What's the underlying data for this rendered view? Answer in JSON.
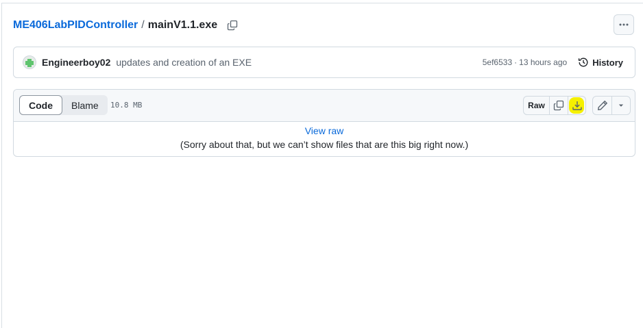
{
  "breadcrumb": {
    "repo": "ME406LabPIDController",
    "separator": "/",
    "file": "mainV1.1.exe"
  },
  "commit": {
    "author": "Engineerboy02",
    "message": "updates and creation of an EXE",
    "sha": "5ef6533",
    "dot": "·",
    "time": "13 hours ago",
    "history_label": "History"
  },
  "file_header": {
    "tabs": [
      {
        "label": "Code",
        "selected": true
      },
      {
        "label": "Blame",
        "selected": false
      }
    ],
    "size": "10.8 MB",
    "raw_label": "Raw"
  },
  "file_body": {
    "view_raw": "View raw",
    "message": "(Sorry about that, but we can’t show files that are this big right now.)"
  },
  "icons": {
    "copy_path": "copy-icon",
    "more": "kebab-horizontal-icon",
    "history": "history-icon",
    "copy_raw": "copy-icon",
    "download": "download-icon",
    "edit": "pencil-icon",
    "dropdown": "triangle-down-icon"
  },
  "colors": {
    "link": "#0969da",
    "highlight": "#f5f000",
    "header_bg": "#f6f8fa",
    "border": "#d1d9e0"
  }
}
